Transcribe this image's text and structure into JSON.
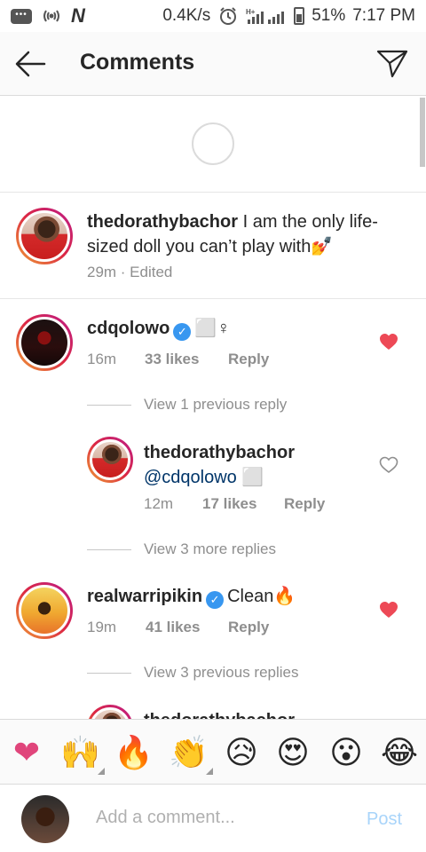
{
  "status_bar": {
    "network_speed": "0.4K/s",
    "network_type": "H+",
    "battery": "51%",
    "time": "7:17 PM",
    "icons": [
      "chat-icon",
      "wifi-tether-icon",
      "n-logo-icon",
      "alarm-icon",
      "signal-icon",
      "battery-icon"
    ]
  },
  "header": {
    "title": "Comments",
    "back_icon": "back-arrow-icon",
    "send_icon": "send-icon"
  },
  "caption": {
    "username": "thedorathybachor",
    "text": "I am the only life-sized doll you can’t play with💅",
    "line1": "I am the only life-",
    "line2": "sized doll you can’t play with💅",
    "time": "29m · Edited"
  },
  "comments": [
    {
      "username": "cdqolowo",
      "verified": true,
      "text": "⬜♀",
      "time": "16m",
      "likes": "33 likes",
      "reply": "Reply",
      "liked": true
    },
    {
      "username": "thedorathybachor",
      "verified": false,
      "text": "@cdqolowo ⬜",
      "time": "12m",
      "likes": "17 likes",
      "reply": "Reply",
      "liked": false
    },
    {
      "username": "realwarripikin",
      "verified": true,
      "text": "Clean🔥",
      "time": "19m",
      "likes": "41 likes",
      "reply": "Reply",
      "liked": true
    },
    {
      "username": "thedorathybachor"
    }
  ],
  "view_links": {
    "prev1": "View 1 previous reply",
    "more3": "View 3 more replies",
    "prev3": "View 3 previous replies"
  },
  "emoji_bar": [
    "❤",
    "🙌",
    "🔥",
    "👏",
    "😥",
    "😍",
    "😮",
    "😂"
  ],
  "composer": {
    "placeholder": "Add a comment...",
    "post_label": "Post"
  },
  "colors": {
    "accent_blue": "#3897f0",
    "post_disabled": "#a8d4fa",
    "like_red": "#ed4956",
    "meta_gray": "#8e8e8e"
  }
}
